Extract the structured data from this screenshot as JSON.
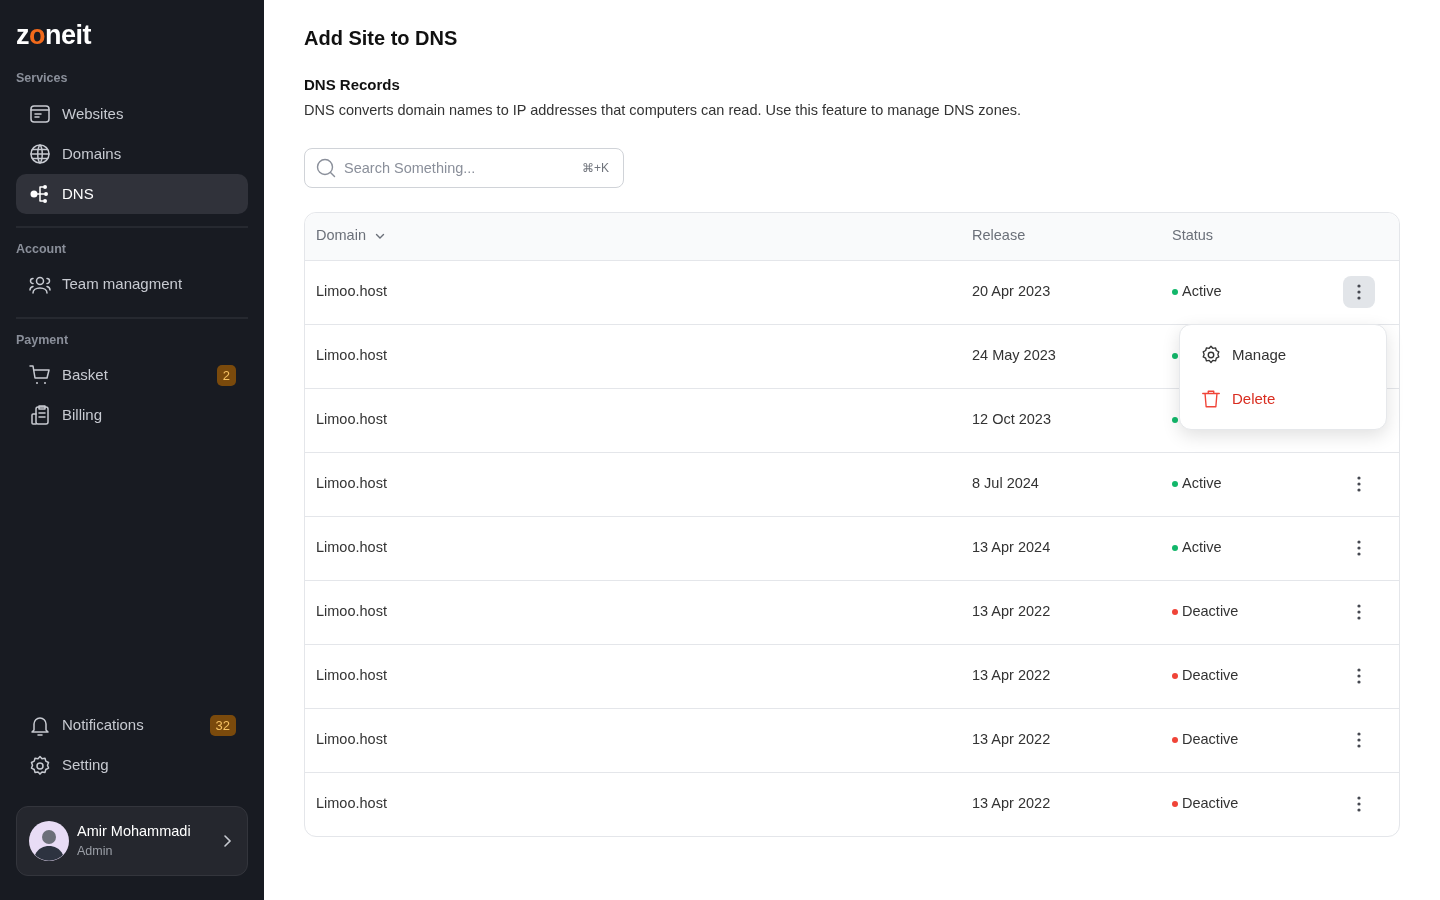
{
  "sidebar": {
    "logo": {
      "before": "z",
      "accent": "o",
      "after": "neit"
    },
    "sections": [
      {
        "title": "Services",
        "items": [
          {
            "label": "Websites",
            "selected": false
          },
          {
            "label": "Domains",
            "selected": false
          },
          {
            "label": "DNS",
            "selected": true
          }
        ]
      },
      {
        "title": "Account",
        "items": [
          {
            "label": "Team managment",
            "selected": false
          }
        ]
      },
      {
        "title": "Payment",
        "items": [
          {
            "label": "Basket",
            "selected": false,
            "badge": "2"
          },
          {
            "label": "Billing",
            "selected": false
          }
        ]
      }
    ],
    "bottom_items": [
      {
        "label": "Notifications",
        "selected": false,
        "badge": "32"
      },
      {
        "label": "Setting",
        "selected": false
      }
    ],
    "user": {
      "name": "Amir Mohammadi",
      "role": "Admin"
    }
  },
  "page": {
    "title": "Add Site to DNS",
    "section_title": "DNS Records",
    "description": "DNS converts domain names to IP addresses that computers can read. Use this feature to manage DNS zones."
  },
  "search": {
    "placeholder": "Search Something...",
    "shortcut": "⌘+K"
  },
  "table": {
    "columns": [
      "Domain",
      "Release",
      "Status"
    ],
    "rows": [
      {
        "domain": "Limoo.host",
        "release": "20 Apr 2023",
        "status": "Active",
        "color": "#12b76a",
        "menu_open": true
      },
      {
        "domain": "Limoo.host",
        "release": "24 May 2023",
        "color": "#12b76a",
        "menu_open": false
      },
      {
        "domain": "Limoo.host",
        "release": "12 Oct 2023",
        "color": "#12b76a",
        "menu_open": false
      },
      {
        "domain": "Limoo.host",
        "release": "8 Jul 2024",
        "status": "Active",
        "color": "#12b76a",
        "menu_open": false
      },
      {
        "domain": "Limoo.host",
        "release": "13 Apr 2024",
        "status": "Active",
        "color": "#12b76a",
        "menu_open": false
      },
      {
        "domain": "Limoo.host",
        "release": "13 Apr 2022",
        "status": "Deactive",
        "color": "#f04438",
        "menu_open": false
      },
      {
        "domain": "Limoo.host",
        "release": "13 Apr 2022",
        "status": "Deactive",
        "color": "#f04438",
        "menu_open": false
      },
      {
        "domain": "Limoo.host",
        "release": "13 Apr 2022",
        "status": "Deactive",
        "color": "#f04438",
        "menu_open": false
      },
      {
        "domain": "Limoo.host",
        "release": "13 Apr 2022",
        "status": "Deactive",
        "color": "#f04438",
        "menu_open": false
      }
    ],
    "row_menu": [
      {
        "label": "Manage",
        "kind": "normal"
      },
      {
        "label": "Delete",
        "kind": "danger"
      }
    ]
  }
}
